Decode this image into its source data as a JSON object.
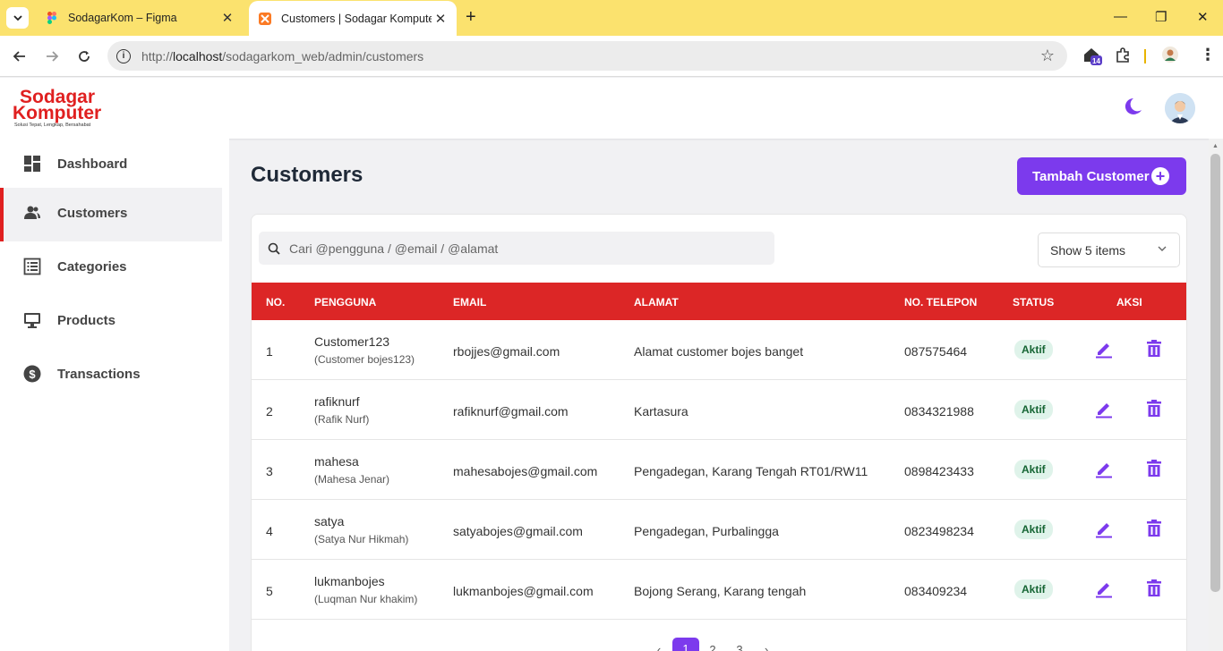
{
  "browser": {
    "tabs": [
      {
        "title": "SodagarKom – Figma",
        "active": false
      },
      {
        "title": "Customers | Sodagar Komputer",
        "active": true
      }
    ],
    "url_prefix": "http://",
    "url_host": "localhost",
    "url_path": "/sodagarkom_web/admin/customers",
    "extension_badge": "14",
    "new_tab_icon": "plus-icon"
  },
  "brand": {
    "line1": "Sodagar",
    "line2": "Komputer",
    "tagline": "Solusi Tepat, Lengkap, Bersahabat",
    "color": "#e02020"
  },
  "sidebar": {
    "items": [
      {
        "label": "Dashboard",
        "icon": "dashboard-icon",
        "active": false
      },
      {
        "label": "Customers",
        "icon": "users-icon",
        "active": true
      },
      {
        "label": "Categories",
        "icon": "list-icon",
        "active": false
      },
      {
        "label": "Products",
        "icon": "monitor-icon",
        "active": false
      },
      {
        "label": "Transactions",
        "icon": "dollar-icon",
        "active": false
      }
    ]
  },
  "main": {
    "title": "Customers",
    "add_button": "Tambah Customer",
    "search_placeholder": "Cari @pengguna / @email / @alamat",
    "page_size": "Show 5 items"
  },
  "table": {
    "headers": [
      "NO.",
      "PENGGUNA",
      "EMAIL",
      "ALAMAT",
      "NO. TELEPON",
      "STATUS",
      "AKSI"
    ],
    "rows": [
      {
        "no": "1",
        "username": "Customer123",
        "fullname": "(Customer bojes123)",
        "email": "rbojjes@gmail.com",
        "alamat": "Alamat customer bojes banget",
        "phone": "087575464",
        "status": "Aktif"
      },
      {
        "no": "2",
        "username": "rafiknurf",
        "fullname": "(Rafik Nurf)",
        "email": "rafiknurf@gmail.com",
        "alamat": "Kartasura",
        "phone": "0834321988",
        "status": "Aktif"
      },
      {
        "no": "3",
        "username": "mahesa",
        "fullname": "(Mahesa Jenar)",
        "email": "mahesabojes@gmail.com",
        "alamat": "Pengadegan, Karang Tengah RT01/RW11",
        "phone": "0898423433",
        "status": "Aktif"
      },
      {
        "no": "4",
        "username": "satya",
        "fullname": "(Satya Nur Hikmah)",
        "email": "satyabojes@gmail.com",
        "alamat": "Pengadegan, Purbalingga",
        "phone": "0823498234",
        "status": "Aktif"
      },
      {
        "no": "5",
        "username": "lukmanbojes",
        "fullname": "(Luqman Nur khakim)",
        "email": "lukmanbojes@gmail.com",
        "alamat": "Bojong Serang, Karang tengah",
        "phone": "083409234",
        "status": "Aktif"
      }
    ]
  },
  "pagination": {
    "prev": "‹",
    "pages": [
      "1",
      "2",
      "3"
    ],
    "current": "1",
    "next": "›"
  },
  "colors": {
    "accent": "#7c3aed",
    "header_red": "#dc2626",
    "badge_bg": "#dff3ea",
    "tabbar": "#fbe26e"
  }
}
